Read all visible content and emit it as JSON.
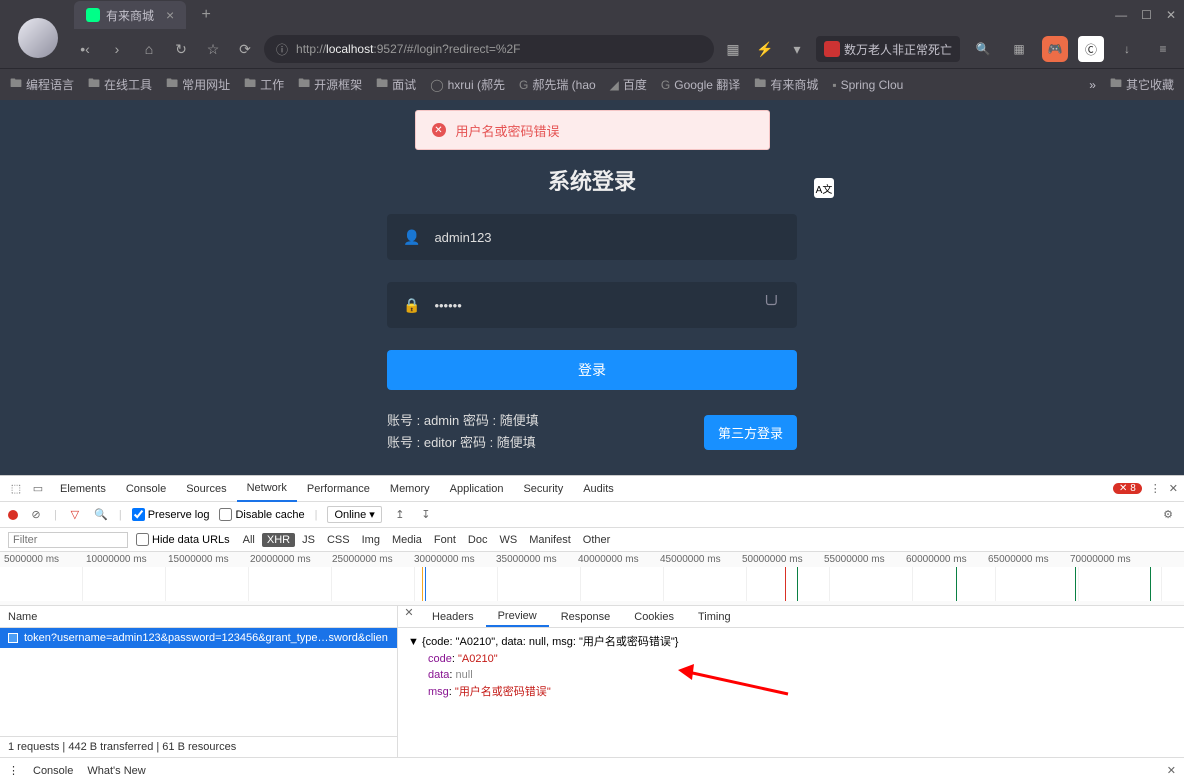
{
  "browser": {
    "tab_title": "有来商城",
    "url_prefix": "http://",
    "url_host": "localhost",
    "url_rest": ":9527/#/login?redirect=%2F",
    "headline": "数万老人非正常死亡"
  },
  "bookmarks": [
    "编程语言",
    "在线工具",
    "常用网址",
    "工作",
    "开源框架",
    "面试",
    "hxrui (郝先",
    "郝先瑞 (hao",
    "百度",
    "Google 翻译",
    "有来商城",
    "Spring Clou"
  ],
  "bookmarks_right": "其它收藏",
  "login": {
    "error_msg": "用户名或密码错误",
    "title": "系统登录",
    "username": "admin123",
    "password": "••••••",
    "submit": "登录",
    "hint1": "账号 : admin   密码 : 随便填",
    "hint2": "账号 : editor   密码 : 随便填",
    "third": "第三方登录"
  },
  "devtools": {
    "tabs": [
      "Elements",
      "Console",
      "Sources",
      "Network",
      "Performance",
      "Memory",
      "Application",
      "Security",
      "Audits"
    ],
    "err_count": "8",
    "preserve": "Preserve log",
    "disable_cache": "Disable cache",
    "online": "Online",
    "filter_ph": "Filter",
    "hide_urls": "Hide data URLs",
    "types": [
      "All",
      "XHR",
      "JS",
      "CSS",
      "Img",
      "Media",
      "Font",
      "Doc",
      "WS",
      "Manifest",
      "Other"
    ],
    "ticks": [
      "5000000 ms",
      "10000000 ms",
      "15000000 ms",
      "20000000 ms",
      "25000000 ms",
      "30000000 ms",
      "35000000 ms",
      "40000000 ms",
      "45000000 ms",
      "50000000 ms",
      "55000000 ms",
      "60000000 ms",
      "65000000 ms",
      "70000000 ms"
    ],
    "name_hdr": "Name",
    "request": "token?username=admin123&password=123456&grant_type…sword&clien",
    "status": "1 requests   |  442 B transferred   |  61 B resources",
    "resp_tabs": [
      "Headers",
      "Preview",
      "Response",
      "Cookies",
      "Timing"
    ],
    "json_summary": "{code: \"A0210\", data: null, msg: \"用户名或密码错误\"}",
    "code": "A0210",
    "msg": "用户名或密码错误",
    "bottom": [
      "Console",
      "What's New"
    ]
  }
}
